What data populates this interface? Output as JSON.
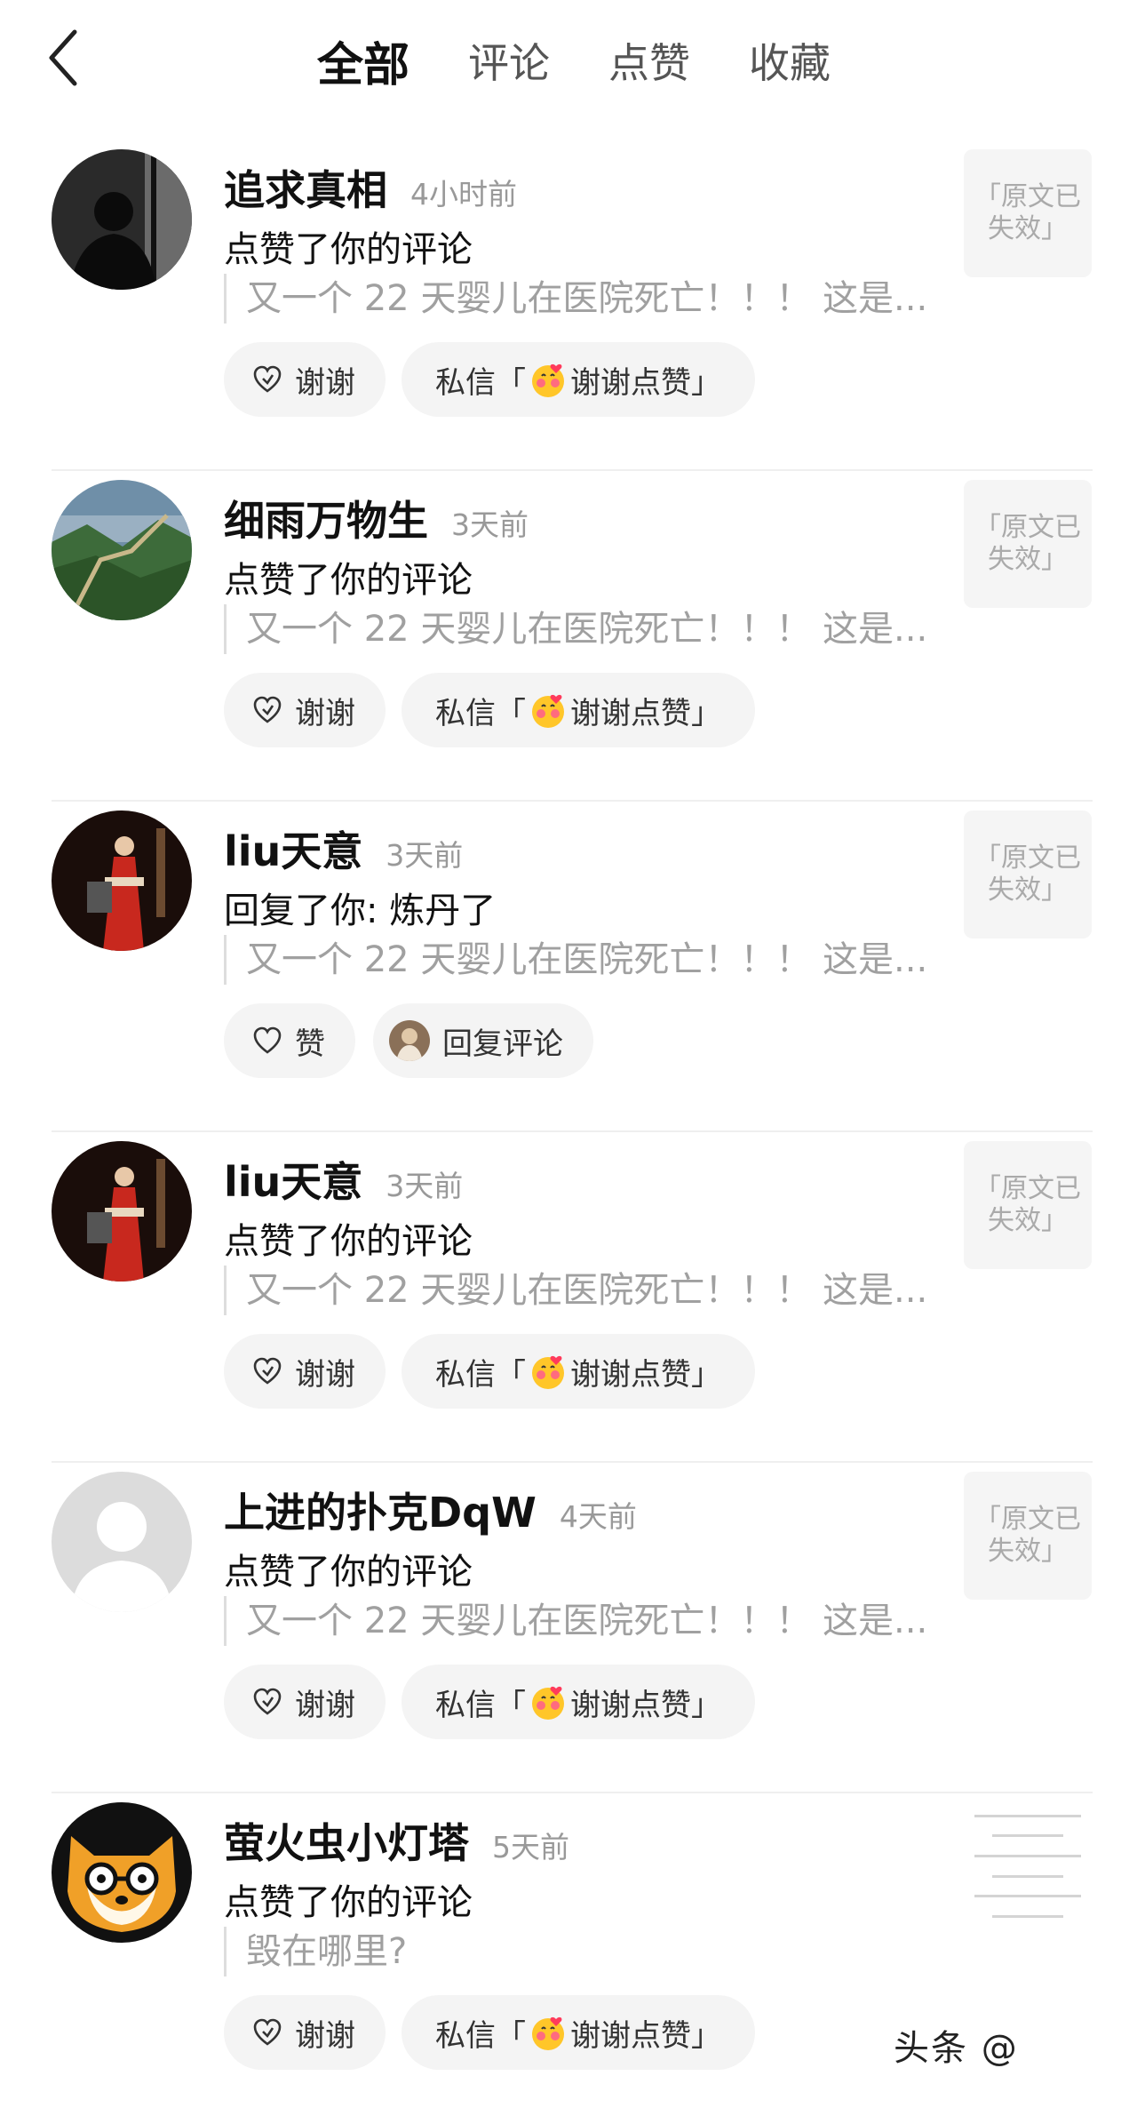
{
  "header": {
    "back_icon": "chevron-left-icon",
    "tabs": [
      {
        "label": "全部",
        "active": true
      },
      {
        "label": "评论",
        "active": false
      },
      {
        "label": "点赞",
        "active": false
      },
      {
        "label": "收藏",
        "active": false
      }
    ]
  },
  "notifications": [
    {
      "name": "追求真相",
      "time": "4小时前",
      "action": "点赞了你的评论",
      "quote": "又一个 22 天婴儿在医院死亡！！！ 这是...",
      "btn1_label": "谢谢",
      "btn1_icon": "heart-thanks-icon",
      "btn2_prefix": "私信「",
      "btn2_text": "谢谢点赞」",
      "thumb": "「原文已\n失效」"
    },
    {
      "name": "细雨万物生",
      "time": "3天前",
      "action": "点赞了你的评论",
      "quote": "又一个 22 天婴儿在医院死亡！！！ 这是...",
      "btn1_label": "谢谢",
      "btn1_icon": "heart-thanks-icon",
      "btn2_prefix": "私信「",
      "btn2_text": "谢谢点赞」",
      "thumb": "「原文已\n失效」"
    },
    {
      "name": "liu天意",
      "time": "3天前",
      "action": "回复了你: 炼丹了",
      "quote": "又一个 22 天婴儿在医院死亡！！！ 这是...",
      "btn1_label": "赞",
      "btn1_icon": "heart-outline-icon",
      "btn2_text": "回复评论",
      "thumb": "「原文已\n失效」"
    },
    {
      "name": "liu天意",
      "time": "3天前",
      "action": "点赞了你的评论",
      "quote": "又一个 22 天婴儿在医院死亡！！！ 这是...",
      "btn1_label": "谢谢",
      "btn1_icon": "heart-thanks-icon",
      "btn2_prefix": "私信「",
      "btn2_text": "谢谢点赞」",
      "thumb": "「原文已\n失效」"
    },
    {
      "name": "上进的扑克DqW",
      "time": "4天前",
      "action": "点赞了你的评论",
      "quote": "又一个 22 天婴儿在医院死亡！！！ 这是...",
      "btn1_label": "谢谢",
      "btn1_icon": "heart-thanks-icon",
      "btn2_prefix": "私信「",
      "btn2_text": "谢谢点赞」",
      "thumb": "「原文已\n失效」"
    },
    {
      "name": "萤火虫小灯塔",
      "time": "5天前",
      "action": "点赞了你的评论",
      "quote": "毁在哪里?",
      "btn1_label": "谢谢",
      "btn1_icon": "heart-thanks-icon",
      "btn2_prefix": "私信「",
      "btn2_text": "谢谢点赞」",
      "thumb_type": "document-thumbnail"
    }
  ],
  "watermark": "头条 @"
}
